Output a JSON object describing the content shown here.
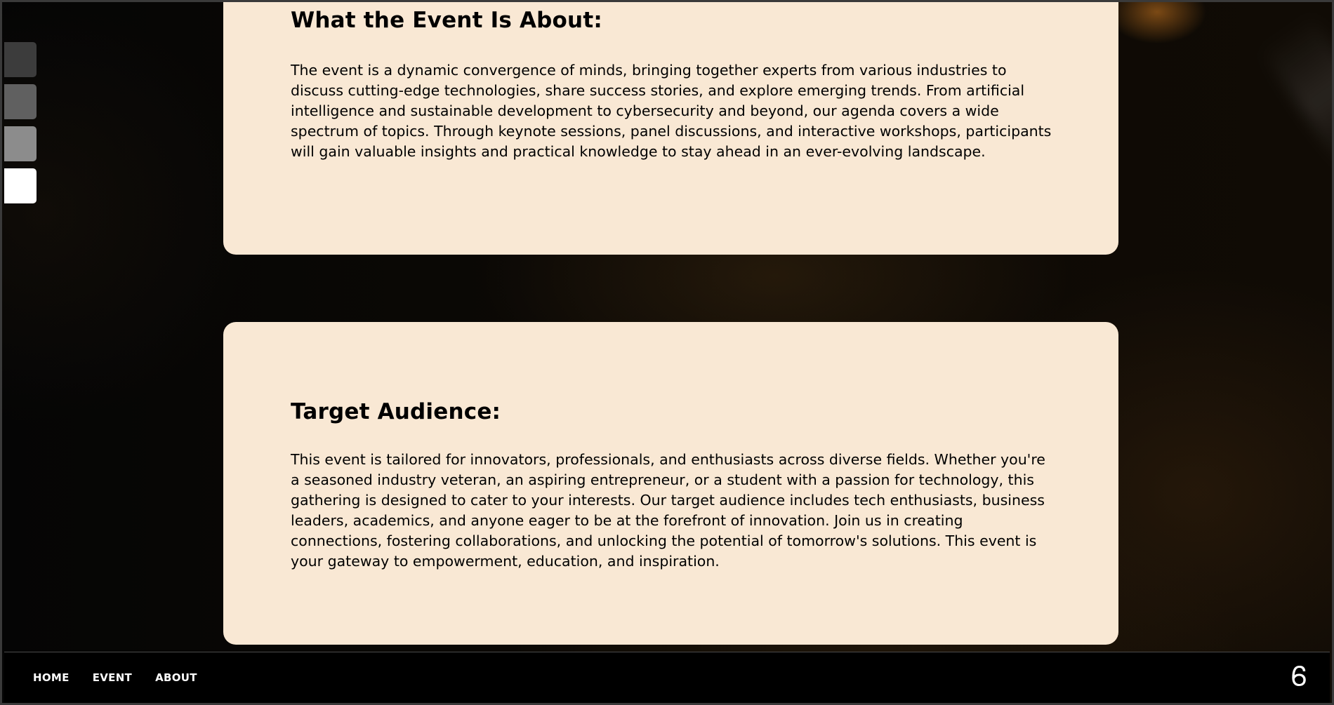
{
  "swatches": [
    {
      "color": "#3c3c3c"
    },
    {
      "color": "#606060"
    },
    {
      "color": "#8c8c8c"
    },
    {
      "color": "#ffffff"
    }
  ],
  "sections": {
    "about": {
      "heading": "What the Event Is About:",
      "body": "The event is a dynamic convergence of minds, bringing together experts from various industries to discuss cutting-edge technologies, share success stories, and explore emerging trends. From artificial intelligence and sustainable development to cybersecurity and beyond, our agenda covers a wide spectrum of topics. Through keynote sessions, panel discussions, and interactive workshops, participants will gain valuable insights and practical knowledge to stay ahead in an ever-evolving landscape."
    },
    "audience": {
      "heading": "Target Audience:",
      "body": "This event is tailored for innovators, professionals, and enthusiasts across diverse fields. Whether you're a seasoned industry veteran, an aspiring entrepreneur, or a student with a passion for technology, this gathering is designed to cater to your interests. Our target audience includes tech enthusiasts, business leaders, academics, and anyone eager to be at the forefront of innovation. Join us in creating connections, fostering collaborations, and unlocking the potential of tomorrow's solutions. This event is your gateway to empowerment, education, and inspiration."
    }
  },
  "footer": {
    "nav": [
      {
        "label": "HOME"
      },
      {
        "label": "EVENT"
      },
      {
        "label": "ABOUT"
      }
    ],
    "logo": "Ꮾ"
  },
  "colors": {
    "card_background": "#f9e8d4",
    "footer_background": "#000000",
    "text": "#000000"
  }
}
